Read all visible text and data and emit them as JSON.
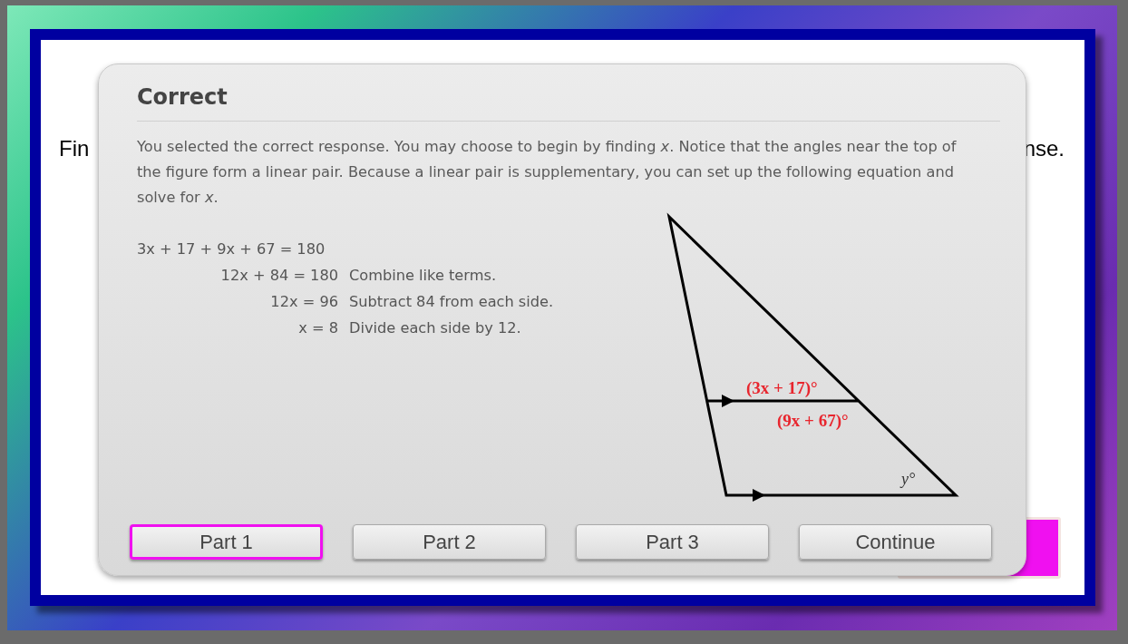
{
  "slide": {
    "prompt_left": "Fin",
    "prompt_right": "nse."
  },
  "dialog": {
    "title": "Correct",
    "explanation": "You selected the correct response. You may choose to begin by finding *x*. Notice that the angles near the top of the figure form a linear pair. Because a linear pair is supplementary, you can set up the following equation and solve for *x*.",
    "steps": [
      {
        "math": "3x + 17 + 9x + 67 = 180"
      },
      {
        "math": "12x + 84 = 180",
        "note": "Combine like terms."
      },
      {
        "math": "12x = 96",
        "note": "Subtract 84 from each side."
      },
      {
        "math": "x = 8",
        "note": "Divide each side by 12."
      }
    ],
    "figure": {
      "top_angle": "(3x + 17)°",
      "bottom_angle": "(9x + 67)°",
      "corner_angle": "y°"
    },
    "buttons": [
      {
        "label": "Part 1",
        "selected": true
      },
      {
        "label": "Part 2",
        "selected": false
      },
      {
        "label": "Part 3",
        "selected": false
      },
      {
        "label": "Continue",
        "selected": false
      }
    ]
  }
}
